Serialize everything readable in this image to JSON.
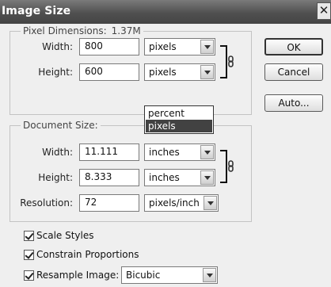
{
  "window": {
    "title": "Image Size",
    "close_glyph": "✕"
  },
  "pixel_dimensions": {
    "label": "Pixel Dimensions:",
    "size": "1.37M",
    "width": {
      "label": "Width:",
      "value": "800",
      "unit": "pixels"
    },
    "height": {
      "label": "Height:",
      "value": "600",
      "unit": "pixels"
    },
    "unit_dropdown": {
      "options": [
        "percent",
        "pixels"
      ],
      "highlighted": "pixels"
    }
  },
  "document_size": {
    "label": "Document Size:",
    "width": {
      "label": "Width:",
      "value": "11.111",
      "unit": "inches"
    },
    "height": {
      "label": "Height:",
      "value": "8.333",
      "unit": "inches"
    },
    "resolution": {
      "label": "Resolution:",
      "value": "72",
      "unit": "pixels/inch"
    }
  },
  "buttons": {
    "ok": "OK",
    "cancel": "Cancel",
    "auto": "Auto..."
  },
  "options": {
    "scale_styles": {
      "label": "Scale Styles",
      "checked": true
    },
    "constrain_proportions": {
      "label": "Constrain Proportions",
      "checked": true
    },
    "resample_image": {
      "label": "Resample Image:",
      "checked": true,
      "method": "Bicubic"
    }
  },
  "icons": [
    "link-chain-icon",
    "link-chain-icon",
    "dropdown-arrow-icon",
    "close-icon",
    "checkbox-checked-icon"
  ]
}
